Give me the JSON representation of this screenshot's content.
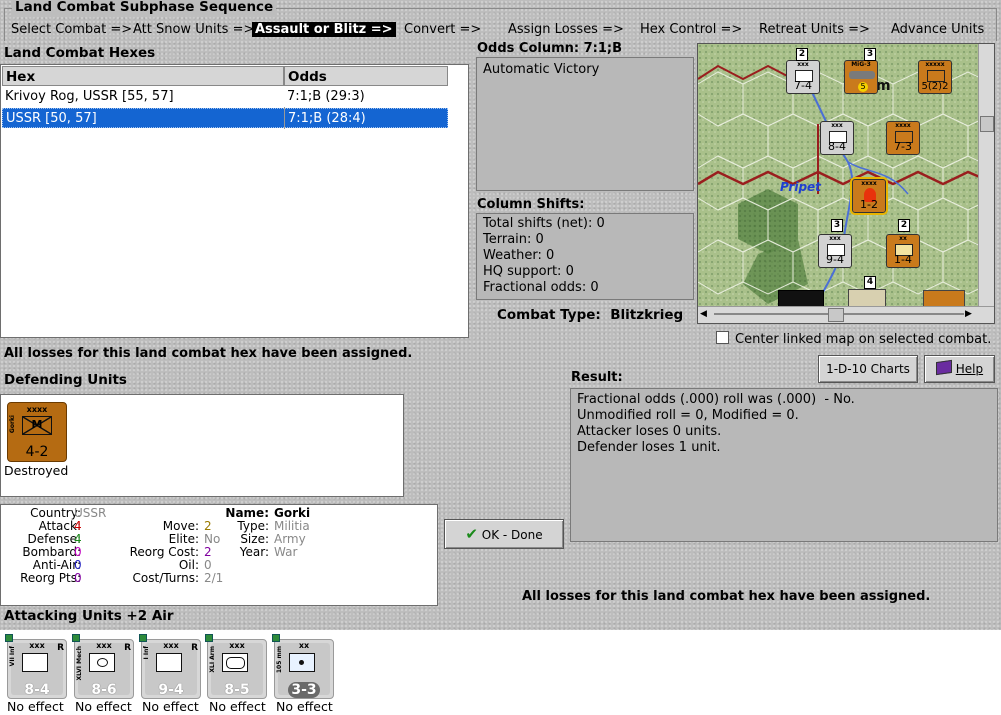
{
  "header": {
    "title": "Land Combat Subphase Sequence",
    "steps": [
      "Select Combat =>",
      "Att Snow Units =>",
      "Assault or Blitz =>",
      "Convert =>",
      "Assign Losses =>",
      "Hex Control =>",
      "Retreat Units =>",
      "Advance Units"
    ],
    "active_step": "Assault or Blitz =>"
  },
  "hexes": {
    "title": "Land Combat Hexes",
    "columns": [
      "Hex",
      "Odds"
    ],
    "rows": [
      {
        "hex": "Krivoy Rog, USSR [55, 57]",
        "odds": "7:1;B (29:3)"
      },
      {
        "hex": "USSR [50, 57]",
        "odds": "7:1;B (28:4)"
      }
    ],
    "selected_row": 1
  },
  "odds": {
    "label": "Odds Column:",
    "value": "7:1;B",
    "text": "Automatic Victory"
  },
  "shifts": {
    "title": "Column Shifts:",
    "items": [
      "Total shifts (net): 0",
      "Terrain: 0",
      "Weather: 0",
      "HQ support: 0",
      "Fractional odds: 0"
    ]
  },
  "combat_type": {
    "label": "Combat Type:",
    "value": "Blitzkrieg"
  },
  "map": {
    "river_label": "Pripet",
    "counters": [
      {
        "val": "7-4",
        "sz": "xxx",
        "side": "axis"
      },
      {
        "val": "5",
        "sz": "MiG-3",
        "side": "soviet-air"
      },
      {
        "val": "5(2)2",
        "sz": "xxxxx",
        "side": "soviet"
      },
      {
        "val": "8-4",
        "sz": "xxx",
        "side": "axis"
      },
      {
        "val": "7-3",
        "sz": "xxxx",
        "side": "soviet"
      },
      {
        "val": "1-2",
        "sz": "xxxx",
        "side": "soviet"
      },
      {
        "val": "9-4",
        "sz": "xxx",
        "side": "axis"
      },
      {
        "val": "1-4",
        "sz": "xx",
        "side": "soviet"
      }
    ],
    "stack_numbers": [
      "2",
      "3",
      "4",
      "3",
      "2",
      "3",
      "2",
      "4",
      "3"
    ],
    "edge_label": "m"
  },
  "center_checkbox": {
    "label": "Center linked map on selected combat.",
    "checked": false
  },
  "losses_msg": "All losses for this land combat hex have been assigned.",
  "buttons": {
    "charts": "1-D-10 Charts",
    "help": "Help",
    "ok": "OK - Done"
  },
  "defending": {
    "title": "Defending Units",
    "unit": {
      "name": "Gorki",
      "size": "xxxx",
      "symbol": "M",
      "val": "4-2",
      "status": "Destroyed"
    }
  },
  "stats": {
    "country_label": "Country:",
    "country": "USSR",
    "attack_label": "Attack:",
    "attack": "4",
    "defense_label": "Defense:",
    "defense": "4",
    "bombard_label": "Bombard:",
    "bombard": "0",
    "antiair_label": "Anti-Air:",
    "antiair": "0",
    "reorgpts_label": "Reorg Pts:",
    "reorgpts": "0",
    "move_label": "Move:",
    "move": "2",
    "elite_label": "Elite:",
    "elite": "No",
    "reorgcost_label": "Reorg Cost:",
    "reorgcost": "2",
    "oil_label": "Oil:",
    "oil": "0",
    "costturns_label": "Cost/Turns:",
    "costturns": "2/1",
    "name_label": "Name:",
    "name": "Gorki",
    "type_label": "Type:",
    "type": "Militia",
    "size_label": "Size:",
    "size": "Army",
    "year_label": "Year:",
    "year": "War"
  },
  "result": {
    "title": "Result:",
    "lines": [
      "Fractional odds (.000) roll was (.000)  - No.",
      "Unmodified roll = 0, Modified = 0.",
      "Attacker loses 0 units.",
      "Defender loses 1 unit."
    ]
  },
  "attacking": {
    "title": "Attacking Units +2 Air",
    "units": [
      {
        "vname": "VII Inf",
        "size": "xxx",
        "val": "8-4",
        "r": "R",
        "note": "No effect",
        "sym": "inf"
      },
      {
        "vname": "XLVI Mech",
        "size": "xxx",
        "val": "8-6",
        "r": "R",
        "note": "No effect",
        "sym": "inf"
      },
      {
        "vname": "I Inf",
        "size": "xxx",
        "val": "9-4",
        "r": "R",
        "note": "No effect",
        "sym": "inf"
      },
      {
        "vname": "XLI Arm",
        "size": "xxx",
        "val": "8-5",
        "r": "",
        "note": "No effect",
        "sym": "arm"
      },
      {
        "vname": "105 mm",
        "size": "xx",
        "val": "3-3",
        "r": "",
        "note": "No effect",
        "sym": "art"
      }
    ]
  },
  "colors": {
    "selection": "#1465d2",
    "soviet_counter": "#c97a1c",
    "axis_counter": "#d2d2d2",
    "attack": "#cc0000",
    "defense": "#1a8a1a",
    "bombard": "#c000c0",
    "antiair": "#2020c0",
    "reorgpts": "#8000a0",
    "move": "#9a7a00",
    "reorgcost": "#8000a0"
  }
}
